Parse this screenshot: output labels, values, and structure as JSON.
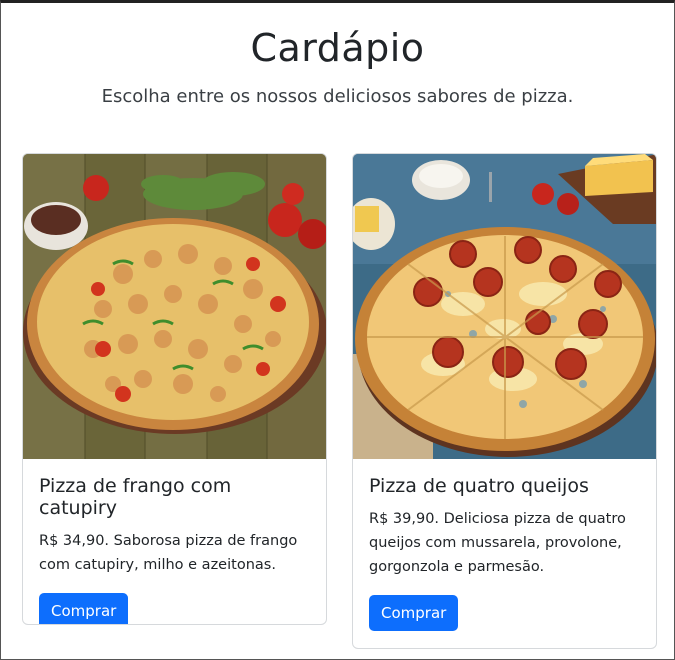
{
  "header": {
    "title": "Cardápio",
    "subtitle": "Escolha entre os nossos deliciosos sabores de pizza."
  },
  "products": [
    {
      "name": "Pizza de frango com catupiry",
      "description": "R$ 34,90. Saborosa pizza de frango com catupiry, milho e azeitonas.",
      "button_label": "Comprar"
    },
    {
      "name": "Pizza de quatro queijos",
      "description": "R$ 39,90. Deliciosa pizza de quatro queijos com mussarela, provolone, gorgonzola e parmesão.",
      "button_label": "Comprar"
    }
  ],
  "colors": {
    "primary_button": "#0d6efd"
  }
}
